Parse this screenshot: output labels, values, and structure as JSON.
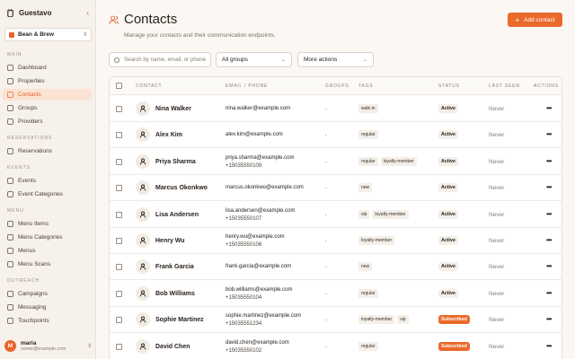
{
  "app": {
    "name": "Guestavo",
    "collapse_icon": "chevron-left-icon"
  },
  "workspace": {
    "name": "Bean & Brew"
  },
  "sidebar": {
    "sections": [
      {
        "title": "MAIN",
        "items": [
          {
            "label": "Dashboard",
            "icon": "dashboard-icon"
          },
          {
            "label": "Properties",
            "icon": "building-icon"
          },
          {
            "label": "Contacts",
            "icon": "users-icon",
            "active": true
          },
          {
            "label": "Groups",
            "icon": "folder-icon"
          },
          {
            "label": "Providers",
            "icon": "plug-icon"
          }
        ]
      },
      {
        "title": "RESERVATIONS",
        "items": [
          {
            "label": "Reservations",
            "icon": "calendar-icon"
          }
        ]
      },
      {
        "title": "EVENTS",
        "items": [
          {
            "label": "Events",
            "icon": "calendar-icon"
          },
          {
            "label": "Event Categories",
            "icon": "tag-icon"
          }
        ]
      },
      {
        "title": "MENU",
        "items": [
          {
            "label": "Menu Items",
            "icon": "utensils-icon"
          },
          {
            "label": "Menu Categories",
            "icon": "folder-icon"
          },
          {
            "label": "Menus",
            "icon": "book-icon"
          },
          {
            "label": "Menu Scans",
            "icon": "scan-icon"
          }
        ]
      },
      {
        "title": "OUTREACH",
        "items": [
          {
            "label": "Campaigns",
            "icon": "megaphone-icon"
          },
          {
            "label": "Messaging",
            "icon": "message-icon"
          },
          {
            "label": "Touchpoints",
            "icon": "pointer-icon"
          }
        ]
      }
    ]
  },
  "user": {
    "initial": "M",
    "name": "maria",
    "email": "owner@example.com"
  },
  "page": {
    "title": "Contacts",
    "subtitle": "Manage your contacts and their communication endpoints.",
    "add_button": "Add contact"
  },
  "filters": {
    "search_placeholder": "Search by name, email, or phone",
    "groups_select": "All groups",
    "actions_select": "More actions"
  },
  "table": {
    "columns": [
      "CONTACT",
      "EMAIL / PHONE",
      "GROUPS",
      "TAGS",
      "STATUS",
      "LAST SEEN",
      "ACTIONS"
    ],
    "rows": [
      {
        "name": "Nina Walker",
        "email": "nina.walker@example.com",
        "phone": "",
        "groups": "-",
        "tags": [
          "walk-in"
        ],
        "status": "Active",
        "last_seen": "Never"
      },
      {
        "name": "Alex Kim",
        "email": "alex.kim@example.com",
        "phone": "",
        "groups": "-",
        "tags": [
          "regular"
        ],
        "status": "Active",
        "last_seen": "Never"
      },
      {
        "name": "Priya Sharma",
        "email": "priya.sharma@example.com",
        "phone": "+15035550109",
        "groups": "-",
        "tags": [
          "regular",
          "loyalty-member"
        ],
        "status": "Active",
        "last_seen": "Never"
      },
      {
        "name": "Marcus Okonkwo",
        "email": "marcus.okonkwo@example.com",
        "phone": "",
        "groups": "-",
        "tags": [
          "new"
        ],
        "status": "Active",
        "last_seen": "Never"
      },
      {
        "name": "Lisa Andersen",
        "email": "lisa.andersen@example.com",
        "phone": "+15035550107",
        "groups": "-",
        "tags": [
          "vip",
          "loyalty-member"
        ],
        "status": "Active",
        "last_seen": "Never"
      },
      {
        "name": "Henry Wu",
        "email": "henry.wu@example.com",
        "phone": "+15035550106",
        "groups": "-",
        "tags": [
          "loyalty-member"
        ],
        "status": "Active",
        "last_seen": "Never"
      },
      {
        "name": "Frank Garcia",
        "email": "frank.garcia@example.com",
        "phone": "",
        "groups": "-",
        "tags": [
          "new"
        ],
        "status": "Active",
        "last_seen": "Never"
      },
      {
        "name": "Bob Williams",
        "email": "bob.williams@example.com",
        "phone": "+15035550104",
        "groups": "-",
        "tags": [
          "regular"
        ],
        "status": "Active",
        "last_seen": "Never"
      },
      {
        "name": "Sophie Martinez",
        "email": "sophie.martinez@example.com",
        "phone": "+15035551234",
        "groups": "-",
        "tags": [
          "loyalty-member",
          "vip"
        ],
        "status": "Subscribed",
        "last_seen": "Never"
      },
      {
        "name": "David Chen",
        "email": "david.chen@example.com",
        "phone": "+15035550102",
        "groups": "-",
        "tags": [
          "regular"
        ],
        "status": "Subscribed",
        "last_seen": "Never"
      }
    ]
  },
  "colors": {
    "accent": "#ea6a2c",
    "active_nav_bg": "#fbe3d3",
    "sidebar_bg": "#f6f1ea",
    "page_bg": "#fbf8f4"
  }
}
